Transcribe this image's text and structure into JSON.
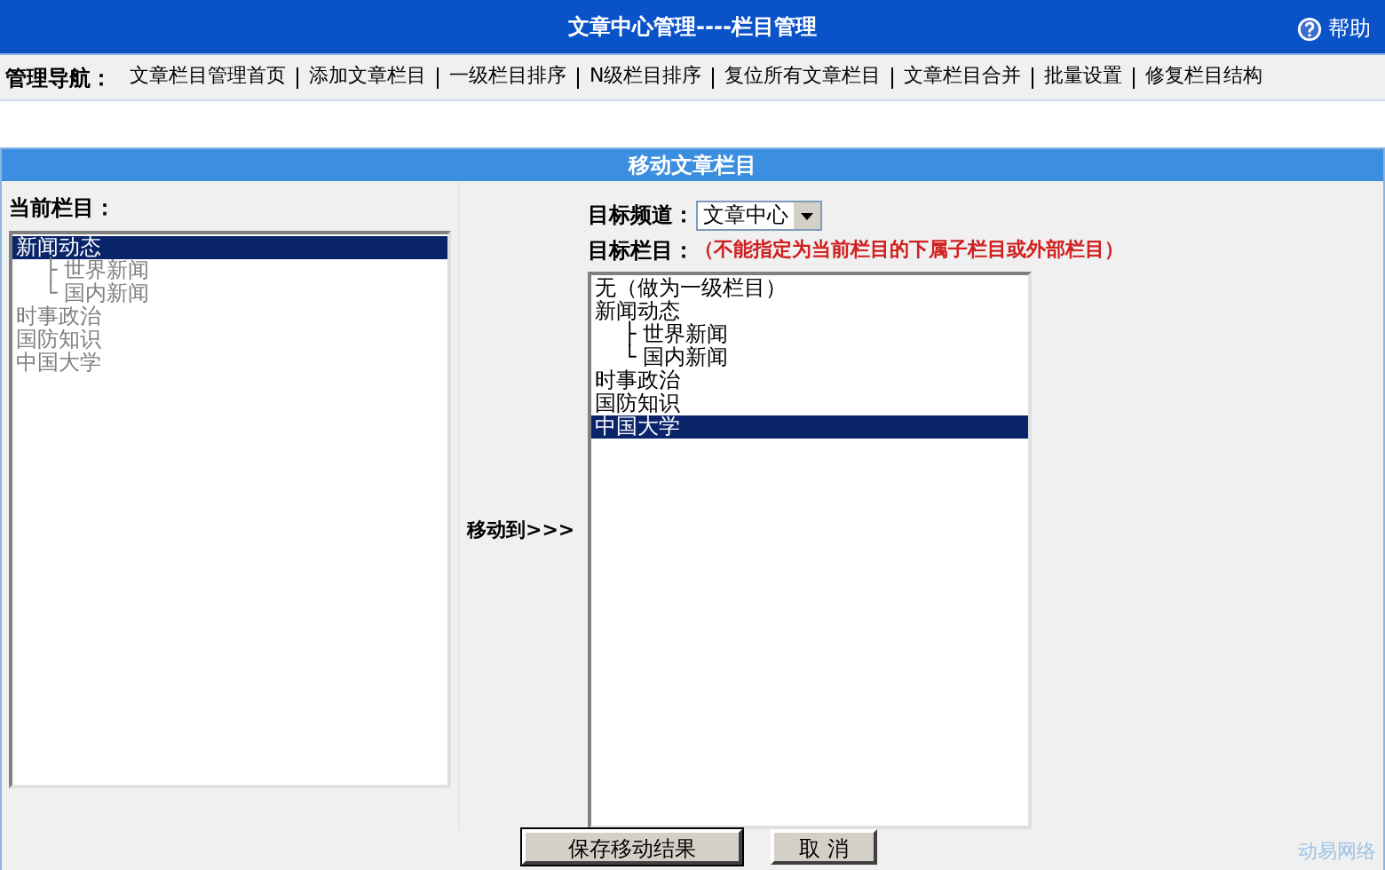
{
  "header": {
    "title": "文章中心管理----栏目管理",
    "help": "帮助"
  },
  "nav": {
    "label": "管理导航：",
    "links": [
      "文章栏目管理首页",
      "添加文章栏目",
      "一级栏目排序",
      "N级栏目排序",
      "复位所有文章栏目",
      "文章栏目合并",
      "批量设置",
      "修复栏目结构"
    ]
  },
  "panel": {
    "title": "移动文章栏目",
    "current": {
      "label": "当前栏目：",
      "disabled": true,
      "items": [
        {
          "text": "新闻动态",
          "selected": true,
          "children": [
            {
              "text": "├ 世界新闻",
              "selected": false
            },
            {
              "text": "└ 国内新闻",
              "selected": false
            }
          ]
        },
        {
          "text": "时事政治",
          "selected": false
        },
        {
          "text": "国防知识",
          "selected": false
        },
        {
          "text": "中国大学",
          "selected": false
        }
      ]
    },
    "move_label": "移动到>>>",
    "channel": {
      "label": "目标频道：",
      "value": "文章中心"
    },
    "target": {
      "label": "目标栏目：",
      "note": "（不能指定为当前栏目的下属子栏目或外部栏目）",
      "disabled": false,
      "items": [
        {
          "text": "无（做为一级栏目）",
          "selected": false
        },
        {
          "text": "新闻动态",
          "selected": false,
          "children": [
            {
              "text": "├ 世界新闻",
              "selected": false
            },
            {
              "text": "└ 国内新闻",
              "selected": false
            }
          ]
        },
        {
          "text": "时事政治",
          "selected": false
        },
        {
          "text": "国防知识",
          "selected": false
        },
        {
          "text": "中国大学",
          "selected": true
        }
      ]
    },
    "buttons": [
      "保存移动结果",
      "取 消"
    ],
    "footer": "动易网络"
  }
}
